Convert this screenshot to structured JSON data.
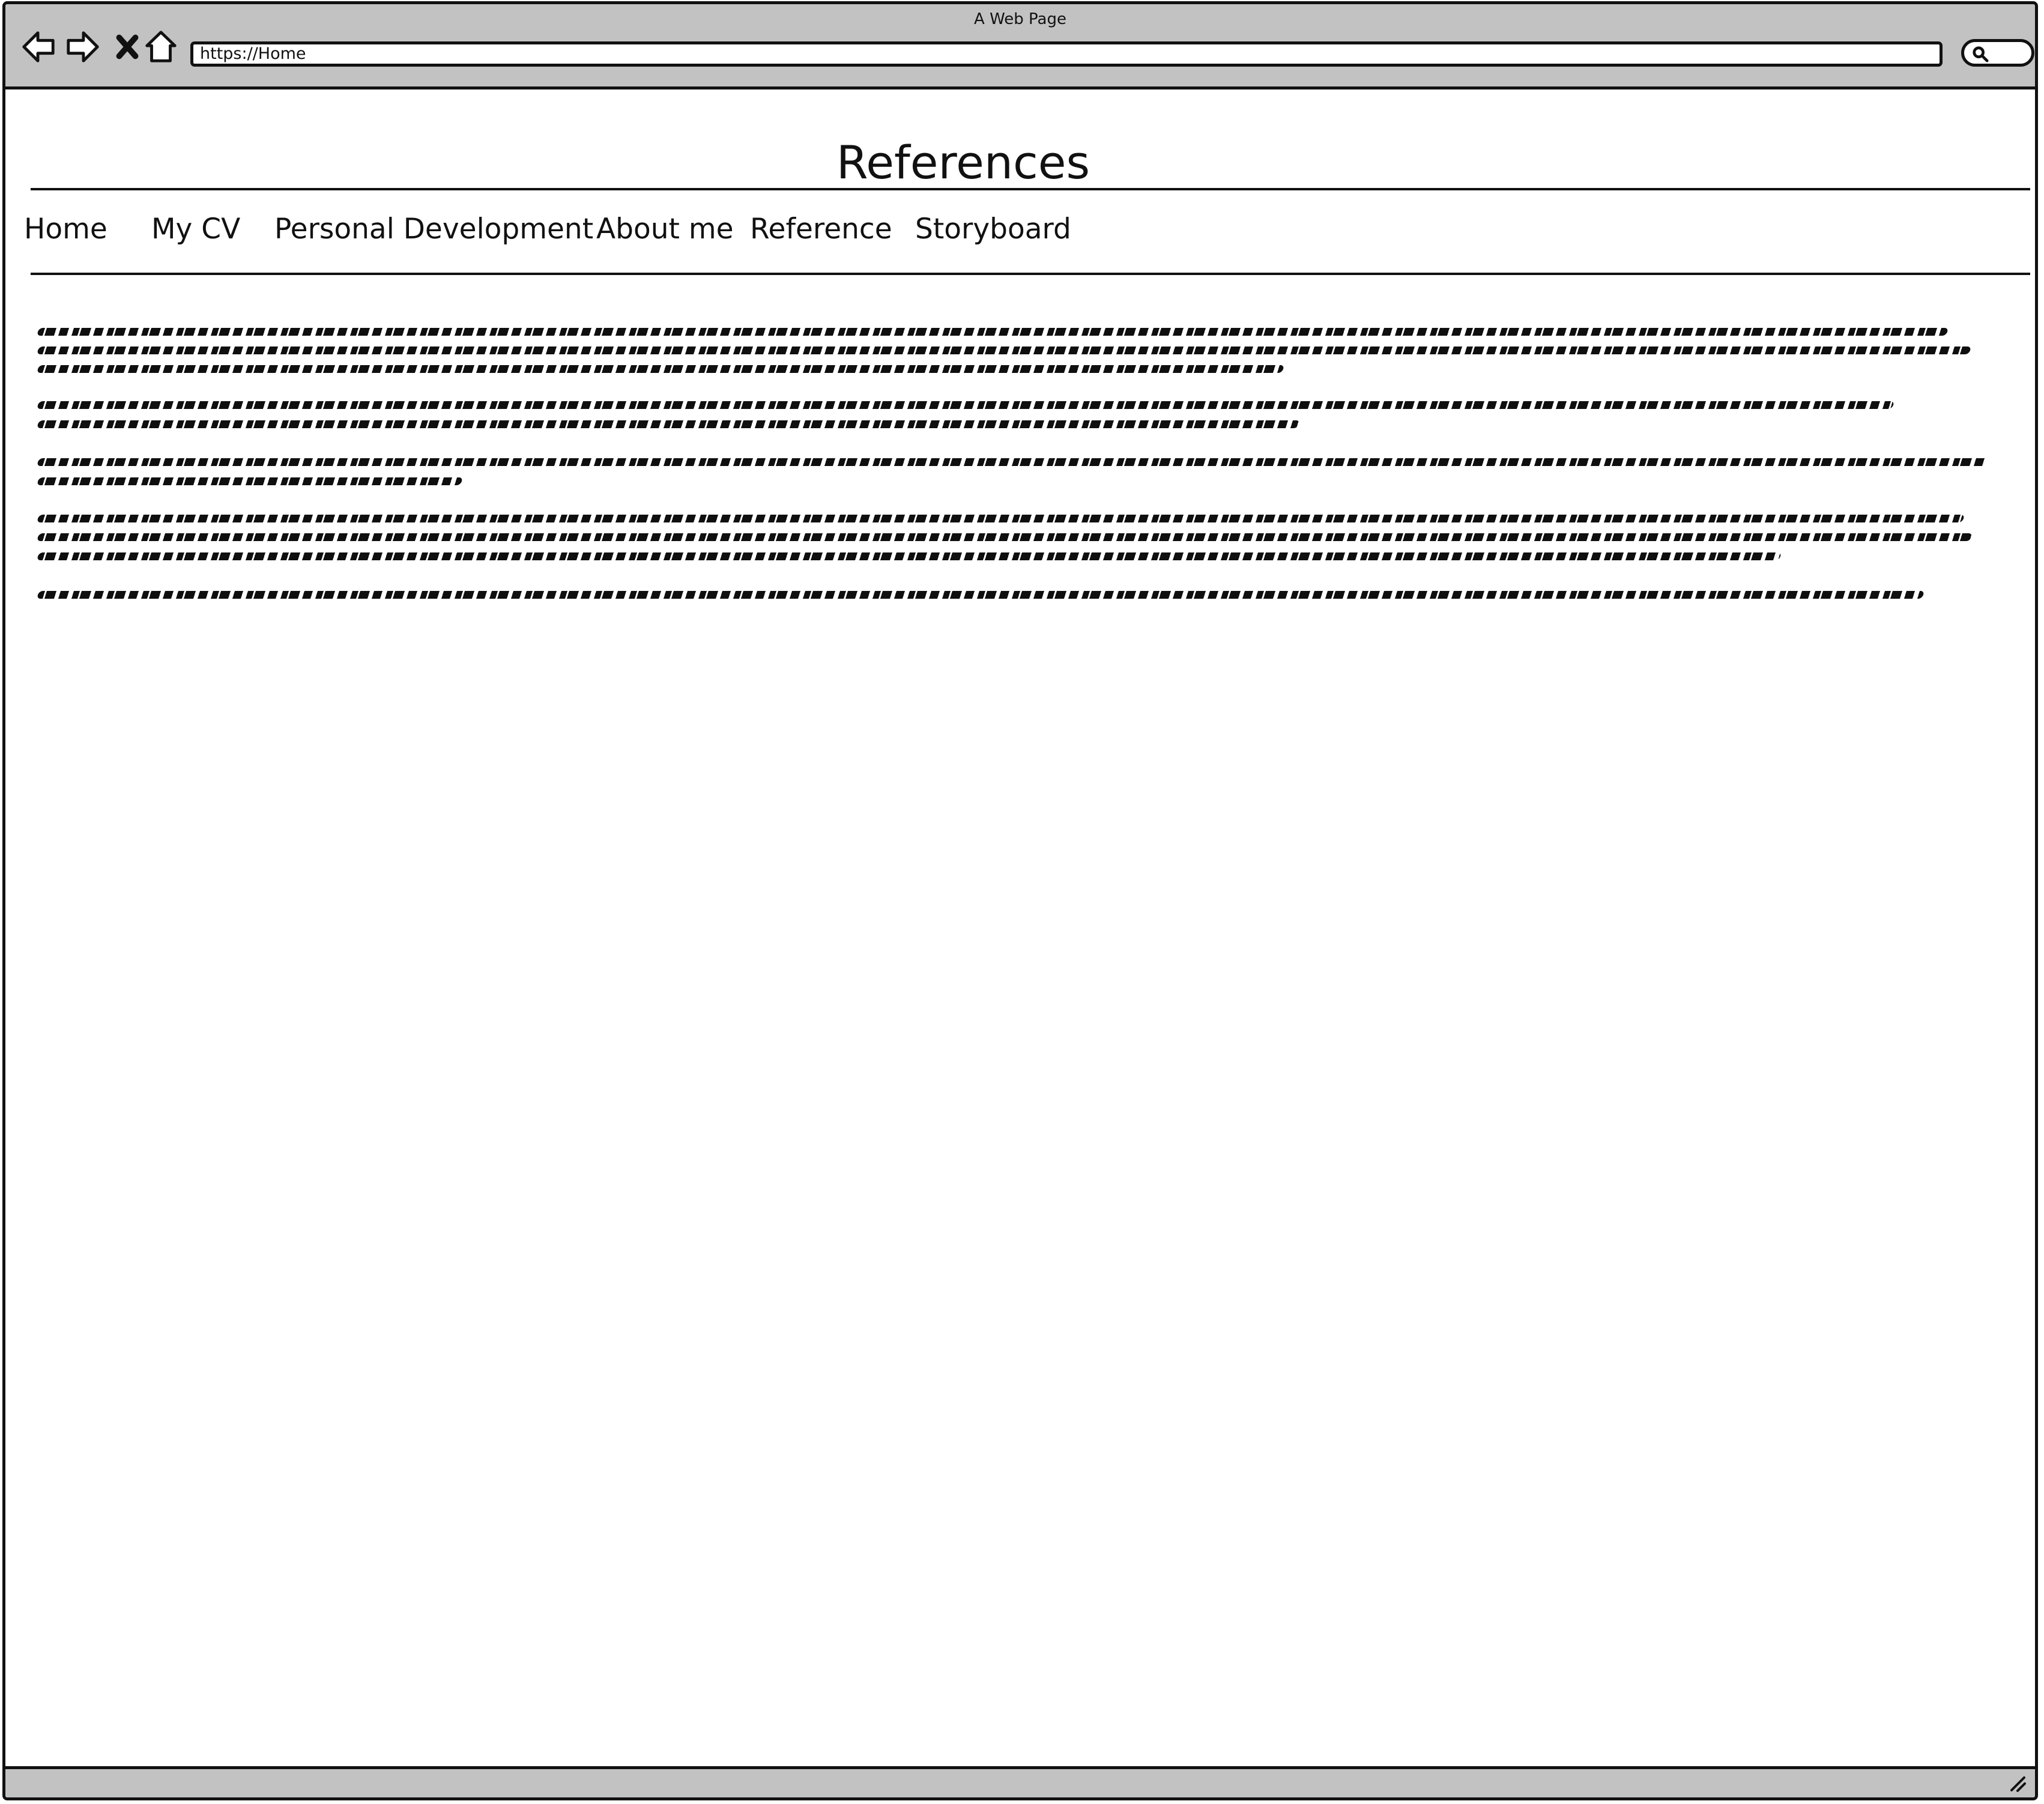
{
  "browser": {
    "title": "A Web Page",
    "url": "https://Home"
  },
  "page": {
    "heading": "References",
    "navigation": [
      "Home",
      "My CV",
      "Personal Development",
      "About me",
      "Reference",
      "Storyboard"
    ]
  },
  "icons": {
    "back": "back-arrow-icon",
    "forward": "forward-arrow-icon",
    "stop": "close-icon",
    "home": "home-icon",
    "search": "search-icon",
    "resize": "resize-grip-icon"
  }
}
